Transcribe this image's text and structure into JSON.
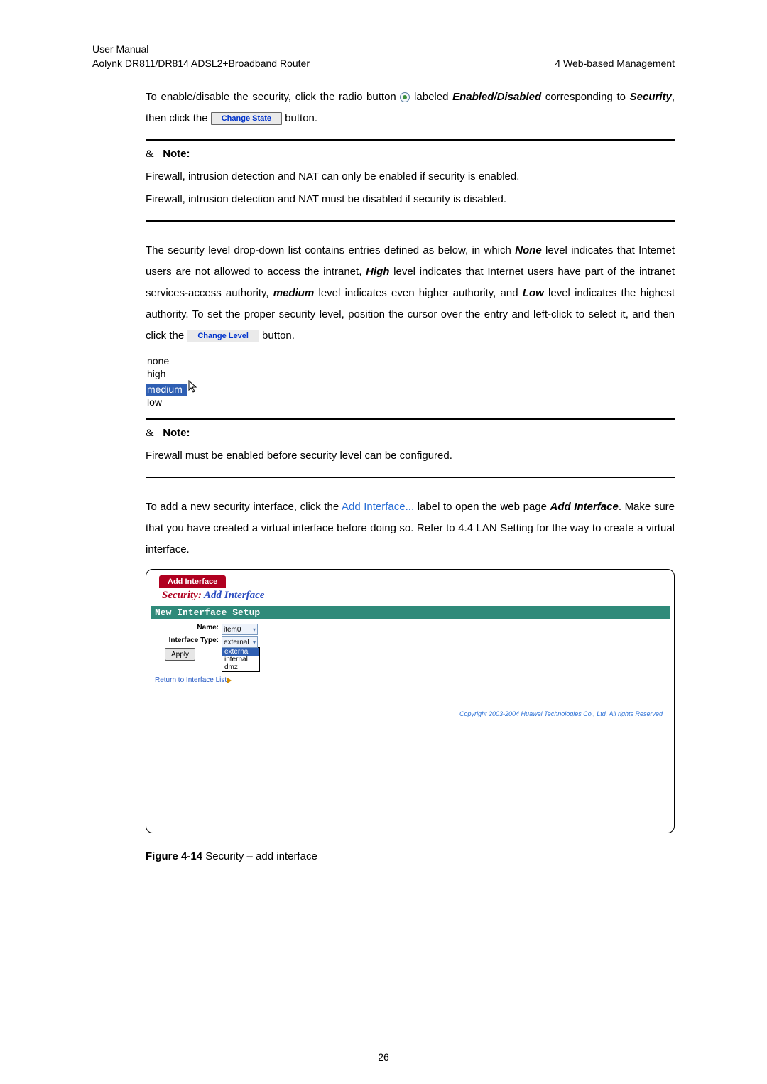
{
  "header": {
    "line1": "User Manual",
    "line2_left": "Aolynk DR811/DR814 ADSL2+Broadband Router",
    "line2_right": "4  Web-based Management"
  },
  "p1": {
    "t1": "To enable/disable the security, click the radio button ",
    "t2": " labeled ",
    "labeled": "Enabled/Disabled",
    "t3": " corresponding to ",
    "security": "Security",
    "t4": ", then click the ",
    "btn": "Change State",
    "t5": " button."
  },
  "note_prefix": "&",
  "note_label": "Note:",
  "note1_l1": "Firewall, intrusion detection and NAT can only be enabled if security is enabled.",
  "note1_l2": "Firewall, intrusion detection and NAT must be disabled if security is disabled.",
  "p2": {
    "a": "The security level drop-down list contains entries defined as below, in which ",
    "none": "None",
    "b": " level indicates that Internet users are not allowed to access the intranet, ",
    "high": "High",
    "c": " level indicates that Internet users have part of the intranet services-access authority, ",
    "medium": "medium",
    "d": " level indicates even higher authority, and ",
    "low": "Low",
    "e": " level indicates the highest authority. To set the proper security level, position the cursor over the entry and left-click to select it, and then click the ",
    "btn": "Change Level",
    "f": " button."
  },
  "dropdown": {
    "none": "none",
    "high": "high",
    "medium": "medium",
    "low": "low"
  },
  "note2": "Firewall must be enabled before security level can be configured.",
  "p3": {
    "a": "To add a new security interface, click the ",
    "link": "Add Interface...",
    "b": " label to open the web page ",
    "add_if": "Add Interface",
    "c": ". Make sure that you have created a virtual interface before doing so. Refer to 4.4  LAN Setting for the way to create a virtual interface."
  },
  "figure": {
    "tab": "Add Interface",
    "title_red": "Security:",
    "title_ital": "Add Interface",
    "bar": "New Interface Setup",
    "name_label": "Name:",
    "name_value": "item0",
    "iftype_label": "Interface Type:",
    "iftype_value": "external",
    "opts": {
      "external": "external",
      "internal": "internal",
      "dmz": "dmz"
    },
    "apply": "Apply",
    "return": "Return to Interface List",
    "copyright": "Copyright 2003-2004 Huawei Technologies Co., Ltd. All rights Reserved"
  },
  "caption": {
    "fig": "Figure 4-14",
    "rest": " Security – add interface"
  },
  "pagenum": "26"
}
